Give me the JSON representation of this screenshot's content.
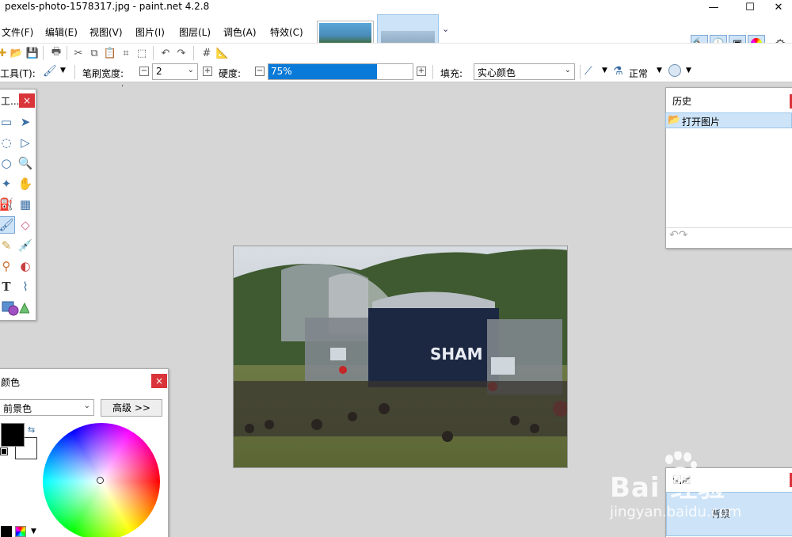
{
  "window": {
    "title": "pexels-photo-1578317.jpg - paint.net 4.2.8",
    "minimize_glyph": "—",
    "maximize_glyph": "☐",
    "close_glyph": "✕"
  },
  "menu": {
    "items": [
      "文件(F)",
      "编辑(E)",
      "视图(V)",
      "图片(I)",
      "图层(L)",
      "调色(A)",
      "特效(C)"
    ]
  },
  "toolbar": {
    "tool_label": "工具(T):",
    "brush_width_label": "笔刷宽度:",
    "brush_width_value": "2",
    "hardness_label": "硬度:",
    "hardness_value": "75%",
    "hardness_fraction": 0.75,
    "fill_label": "填充:",
    "fill_value": "实心颜色",
    "blend_mode": "正常",
    "minus_glyph": "⊟",
    "plus_glyph": "⊞"
  },
  "tools_panel": {
    "title": "工...",
    "close_glyph": "×"
  },
  "history_panel": {
    "title": "历史",
    "items": [
      "打开图片"
    ]
  },
  "colors_panel": {
    "title": "颜色",
    "close_glyph": "×",
    "mode_value": "前景色",
    "advanced_label": "高级 >>"
  },
  "layers_panel": {
    "title": "图层",
    "layer_name": "背景"
  },
  "canvas_image": {
    "sign_text": "SHAM"
  },
  "watermark": {
    "brand": "Bai 经验",
    "url": "jingyan.baidu.com"
  },
  "colors": {
    "accent": "#0a7ad8",
    "selection": "#cde3f7",
    "close_red": "#d9343a",
    "workspace": "#d6d6d6"
  }
}
